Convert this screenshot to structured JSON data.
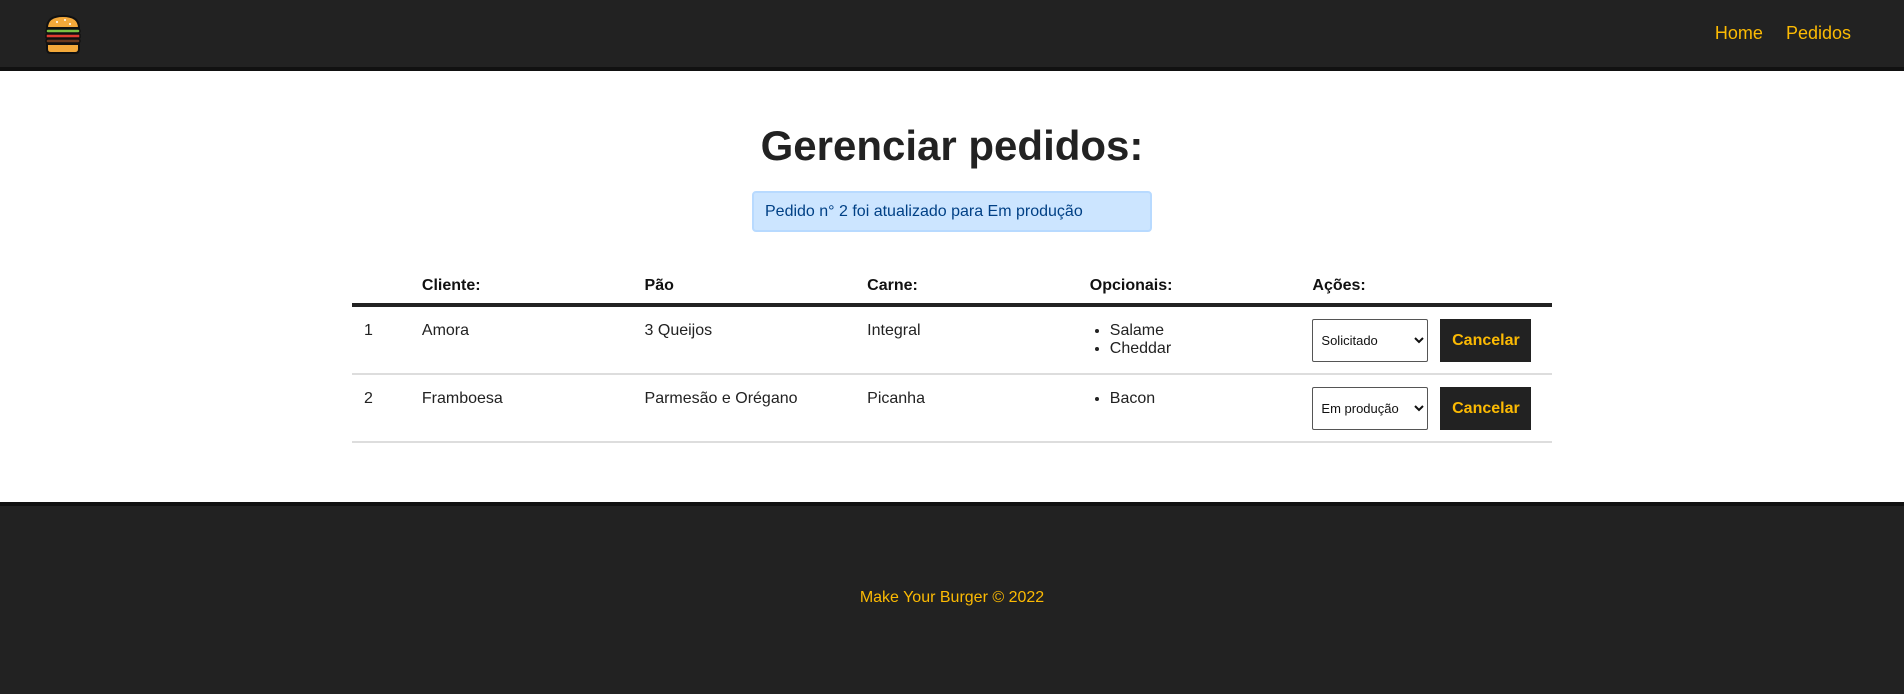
{
  "nav": {
    "logo_icon": "burger-icon",
    "links": [
      "Home",
      "Pedidos"
    ]
  },
  "page": {
    "title": "Gerenciar pedidos:",
    "message": "Pedido n° 2 foi atualizado para Em produção"
  },
  "table": {
    "headers": [
      "",
      "Cliente:",
      "Pão",
      "Carne:",
      "Opcionais:",
      "Ações:"
    ],
    "rows": [
      {
        "id": "1",
        "cliente": "Amora",
        "pao": "3 Queijos",
        "carne": "Integral",
        "opcionais": [
          "Salame",
          "Cheddar"
        ],
        "status": "Solicitado",
        "cancel_label": "Cancelar"
      },
      {
        "id": "2",
        "cliente": "Framboesa",
        "pao": "Parmesão e Orégano",
        "carne": "Picanha",
        "opcionais": [
          "Bacon"
        ],
        "status": "Em produção",
        "cancel_label": "Cancelar"
      }
    ]
  },
  "footer": {
    "text": "Make Your Burger © 2022"
  },
  "colors": {
    "dark": "#222222",
    "accent": "#fcba03",
    "message_bg": "#cce5ff",
    "message_text": "#004085"
  }
}
